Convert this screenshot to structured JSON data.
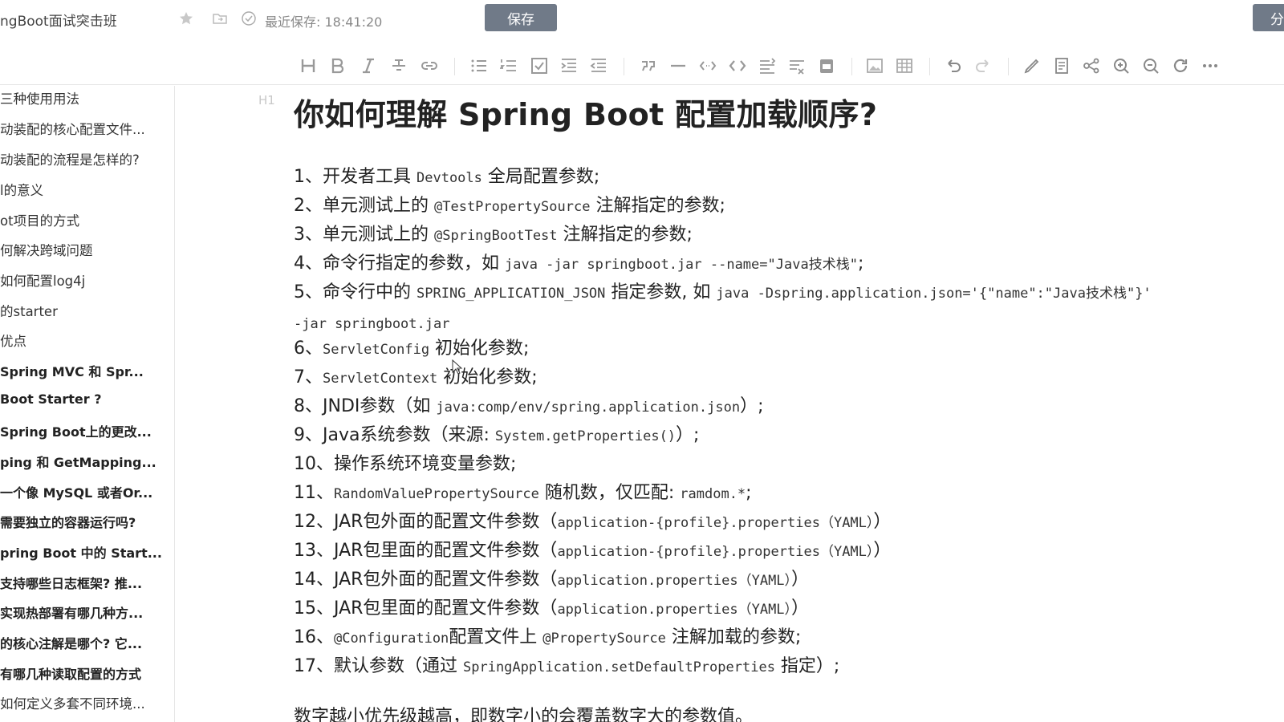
{
  "header": {
    "doc_title": "ngBoot面试突击班",
    "save_status": "最近保存: 18:41:20",
    "save_label": "保存",
    "share_label": "分"
  },
  "toolbar": {
    "icons": [
      "heading-icon",
      "bold-icon",
      "italic-icon",
      "strikethrough-icon",
      "link-icon",
      "bullet-list-icon",
      "numbered-list-icon",
      "checklist-icon",
      "indent-icon",
      "outdent-icon",
      "quote-icon",
      "horizontal-rule-icon",
      "inline-code-icon",
      "code-block-icon",
      "align-icon",
      "format-clear-icon",
      "save-draft-icon",
      "image-icon",
      "table-icon",
      "undo-icon",
      "redo-icon",
      "pen-icon",
      "note-icon",
      "mindmap-icon",
      "zoom-in-icon",
      "zoom-out-icon",
      "refresh-icon",
      "more-icon"
    ]
  },
  "sidebar": {
    "items": [
      {
        "label": "三种使用用法",
        "bold": false
      },
      {
        "label": "动装配的核心配置文件...",
        "bold": false
      },
      {
        "label": "动装配的流程是怎样的?",
        "bold": false
      },
      {
        "label": "l的意义",
        "bold": false
      },
      {
        "label": "ot项目的方式",
        "bold": false
      },
      {
        "label": "何解决跨域问题",
        "bold": false
      },
      {
        "label": "如何配置log4j",
        "bold": false
      },
      {
        "label": "的starter",
        "bold": false
      },
      {
        "label": "优点",
        "bold": false
      },
      {
        "label": "   Spring MVC 和 Spr...",
        "bold": true
      },
      {
        "label": "Boot Starter ?",
        "bold": true
      },
      {
        "label": "Spring Boot上的更改...",
        "bold": true
      },
      {
        "label": "ping 和 GetMapping...",
        "bold": true
      },
      {
        "label": "一个像 MySQL 或者Or...",
        "bold": true
      },
      {
        "label": "需要独立的容器运行吗?",
        "bold": true
      },
      {
        "label": "pring Boot 中的 Start...",
        "bold": true
      },
      {
        "label": "支持哪些日志框架? 推...",
        "bold": true
      },
      {
        "label": "实现热部署有哪几种方...",
        "bold": true
      },
      {
        "label": "的核心注解是哪个? 它...",
        "bold": true
      },
      {
        "label": "有哪几种读取配置的方式",
        "bold": true
      },
      {
        "label": "如何定义多套不同环境...",
        "bold": false
      }
    ]
  },
  "editor": {
    "h1_marker": "H1",
    "title": "你如何理解 Spring Boot 配置加载顺序?",
    "lines": [
      {
        "n": "1、开发者工具 ",
        "code": "Devtools",
        "rest": " 全局配置参数;"
      },
      {
        "n": "2、单元测试上的 ",
        "code": "@TestPropertySource",
        "rest": " 注解指定的参数;"
      },
      {
        "n": "3、单元测试上的 ",
        "code": "@SpringBootTest",
        "rest": " 注解指定的参数;"
      },
      {
        "n": "4、命令行指定的参数，如 ",
        "code": "java -jar springboot.jar --name=\"Java技术栈\"",
        "rest": ";"
      },
      {
        "n": "5、命令行中的 ",
        "code": "SPRING_APPLICATION_JSON",
        "rest": " 指定参数, 如 ",
        "code2": "java -Dspring.application.json='{\"name\":\"Java技术栈\"}'"
      },
      {
        "n": "6、",
        "code": "ServletConfig",
        "rest": " 初始化参数;"
      },
      {
        "n": "7、",
        "code": "ServletContext",
        "rest": " 初始化参数;"
      },
      {
        "n": "8、JNDI参数（如 ",
        "code": "java:comp/env/spring.application.json",
        "rest": "）;"
      },
      {
        "n": "9、Java系统参数（来源: ",
        "code": "System.getProperties()",
        "rest": "）;"
      },
      {
        "n": "10、操作系统环境变量参数;",
        "code": "",
        "rest": ""
      },
      {
        "n": "11、",
        "code": "RandomValuePropertySource",
        "rest": " 随机数，仅匹配: ",
        "code2": "ramdom.*",
        "rest2": ";"
      },
      {
        "n": "12、JAR包外面的配置文件参数（",
        "code": "application-{profile}.properties（YAML）",
        "rest": "）"
      },
      {
        "n": "13、JAR包里面的配置文件参数（",
        "code": "application-{profile}.properties（YAML）",
        "rest": "）"
      },
      {
        "n": "14、JAR包外面的配置文件参数（",
        "code": "application.properties（YAML）",
        "rest": "）"
      },
      {
        "n": "15、JAR包里面的配置文件参数（",
        "code": "application.properties（YAML）",
        "rest": "）"
      },
      {
        "n": "16、",
        "code": "@Configuration",
        "rest": "配置文件上 ",
        "code2": "@PropertySource",
        "rest2": " 注解加载的参数;"
      },
      {
        "n": "17、默认参数（通过 ",
        "code": "SpringApplication.setDefaultProperties",
        "rest": " 指定）;"
      }
    ],
    "line5_cont": "-jar springboot.jar",
    "footer": "数字越小优先级越高，即数字小的会覆盖数字大的参数值。"
  }
}
